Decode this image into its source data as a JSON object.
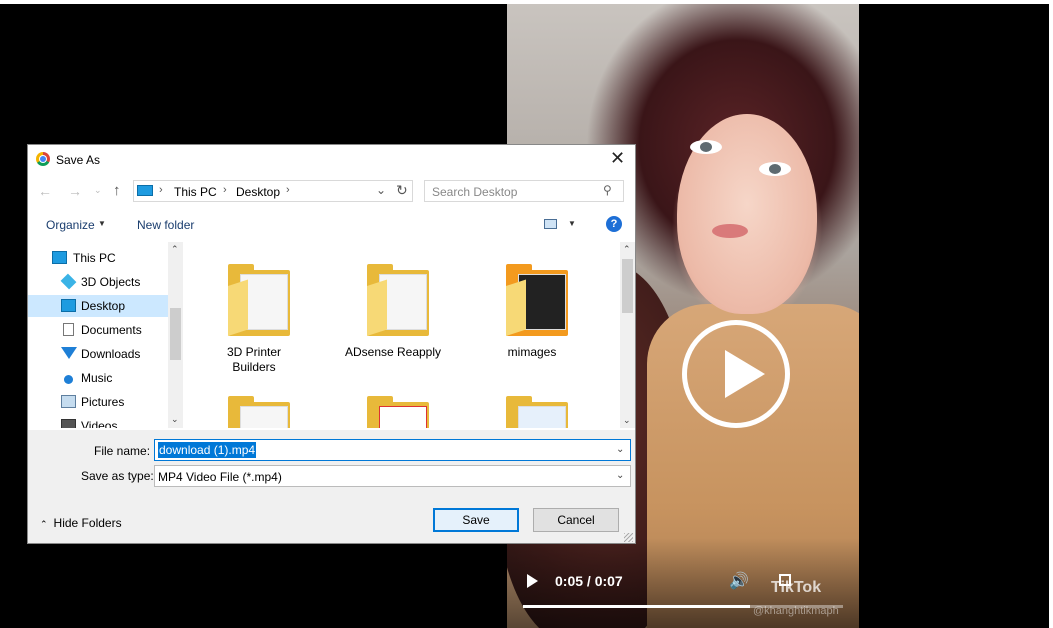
{
  "dialog": {
    "title": "Save As",
    "close_glyph": "✕",
    "nav": {
      "back_glyph": "←",
      "forward_glyph": "→",
      "recent_glyph": "⌄",
      "up_glyph": "↑",
      "address_segments": [
        "This PC",
        "Desktop"
      ],
      "separator_glyph": "›",
      "dropdown_glyph": "⌄",
      "refresh_glyph": "↻",
      "search_placeholder": "Search Desktop",
      "search_glyph": "⚲"
    },
    "toolbar": {
      "organize_label": "Organize",
      "menu_arrow_glyph": "▼",
      "new_folder_label": "New folder",
      "help_glyph": "?"
    },
    "nav_pane": {
      "items": [
        {
          "label": "This PC",
          "icon": "computer-icon",
          "selected": false
        },
        {
          "label": "3D Objects",
          "icon": "cube-icon",
          "selected": false
        },
        {
          "label": "Desktop",
          "icon": "desktop-icon",
          "selected": true
        },
        {
          "label": "Documents",
          "icon": "document-icon",
          "selected": false
        },
        {
          "label": "Downloads",
          "icon": "download-arrow-icon",
          "selected": false
        },
        {
          "label": "Music",
          "icon": "music-note-icon",
          "selected": false
        },
        {
          "label": "Pictures",
          "icon": "picture-icon",
          "selected": false
        },
        {
          "label": "Videos",
          "icon": "video-icon",
          "selected": false
        }
      ],
      "scroll_up_glyph": "⌃",
      "scroll_down_glyph": "⌄"
    },
    "files": [
      {
        "name_lines": [
          "3D Printer",
          "Builders"
        ]
      },
      {
        "name_lines": [
          "ADsense Reapply"
        ]
      },
      {
        "name_lines": [
          "mimages"
        ]
      },
      {
        "name_lines": [
          ""
        ]
      },
      {
        "name_lines": [
          ""
        ]
      },
      {
        "name_lines": [
          ""
        ]
      }
    ],
    "file_name_label": "File name:",
    "file_name_value": "download (1).mp4",
    "save_as_type_label": "Save as type:",
    "save_as_type_value": "MP4 Video File (*.mp4)",
    "hide_folders_label": "Hide Folders",
    "hide_folders_glyph": "⌃",
    "save_label": "Save",
    "cancel_label": "Cancel"
  },
  "video": {
    "time_display": "0:05 / 0:07",
    "progress_fraction": 0.71,
    "volume_glyph": "🔊",
    "watermark": "TikTok",
    "handle": "@khanghtikmaph"
  },
  "colors": {
    "accent": "#0078d7",
    "selection": "#cce8ff",
    "folder": "#e8b93a"
  }
}
